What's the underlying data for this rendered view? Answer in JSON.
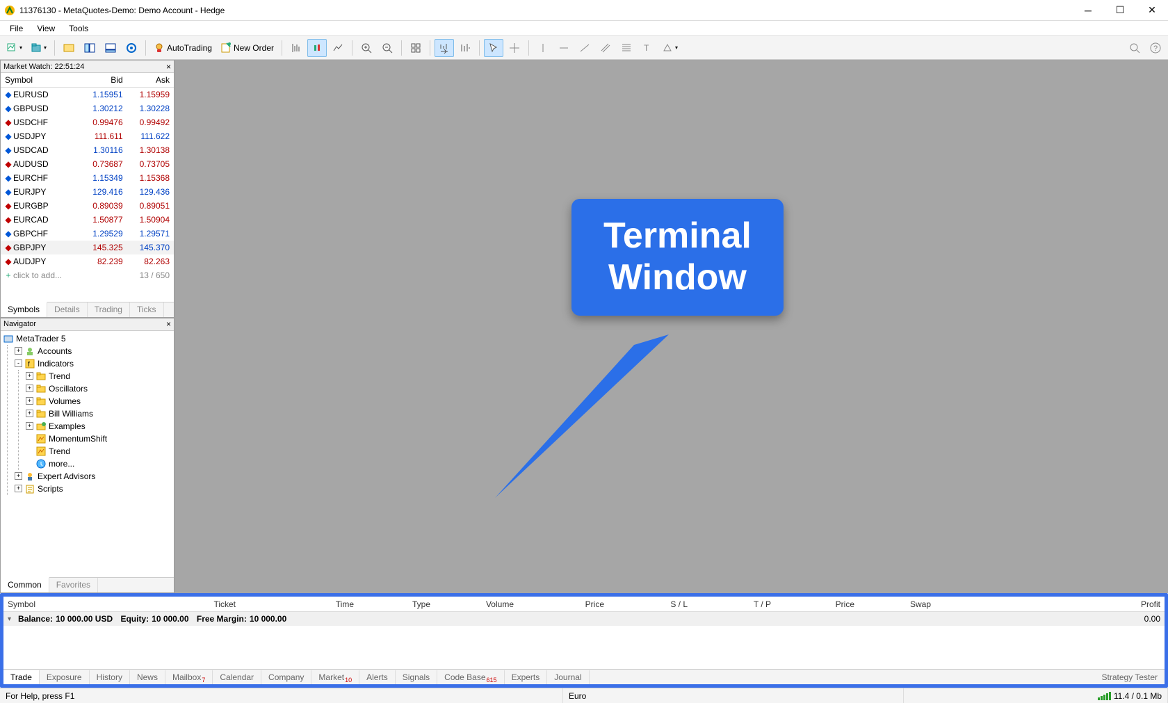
{
  "title": "11376130 - MetaQuotes-Demo: Demo Account - Hedge",
  "menu": [
    "File",
    "View",
    "Tools"
  ],
  "toolbar": {
    "autotrading": "AutoTrading",
    "neworder": "New Order"
  },
  "market_watch": {
    "header": "Market Watch: 22:51:24",
    "cols": {
      "symbol": "Symbol",
      "bid": "Bid",
      "ask": "Ask"
    },
    "rows": [
      {
        "arrow": "up",
        "sym": "EURUSD",
        "bid": "1.15951",
        "ask": "1.15959",
        "bidc": "up",
        "askc": "down"
      },
      {
        "arrow": "up",
        "sym": "GBPUSD",
        "bid": "1.30212",
        "ask": "1.30228",
        "bidc": "up",
        "askc": "up"
      },
      {
        "arrow": "down",
        "sym": "USDCHF",
        "bid": "0.99476",
        "ask": "0.99492",
        "bidc": "down",
        "askc": "down"
      },
      {
        "arrow": "up",
        "sym": "USDJPY",
        "bid": "111.611",
        "ask": "111.622",
        "bidc": "down",
        "askc": "up"
      },
      {
        "arrow": "up",
        "sym": "USDCAD",
        "bid": "1.30116",
        "ask": "1.30138",
        "bidc": "up",
        "askc": "down"
      },
      {
        "arrow": "down",
        "sym": "AUDUSD",
        "bid": "0.73687",
        "ask": "0.73705",
        "bidc": "down",
        "askc": "down"
      },
      {
        "arrow": "up",
        "sym": "EURCHF",
        "bid": "1.15349",
        "ask": "1.15368",
        "bidc": "up",
        "askc": "down"
      },
      {
        "arrow": "up",
        "sym": "EURJPY",
        "bid": "129.416",
        "ask": "129.436",
        "bidc": "up",
        "askc": "up"
      },
      {
        "arrow": "down",
        "sym": "EURGBP",
        "bid": "0.89039",
        "ask": "0.89051",
        "bidc": "down",
        "askc": "down"
      },
      {
        "arrow": "down",
        "sym": "EURCAD",
        "bid": "1.50877",
        "ask": "1.50904",
        "bidc": "down",
        "askc": "down"
      },
      {
        "arrow": "up",
        "sym": "GBPCHF",
        "bid": "1.29529",
        "ask": "1.29571",
        "bidc": "up",
        "askc": "up"
      },
      {
        "arrow": "down",
        "sym": "GBPJPY",
        "bid": "145.325",
        "ask": "145.370",
        "bidc": "down",
        "askc": "up",
        "sel": true
      },
      {
        "arrow": "down",
        "sym": "AUDJPY",
        "bid": "82.239",
        "ask": "82.263",
        "bidc": "down",
        "askc": "down"
      }
    ],
    "add_text": "click to add...",
    "counter": "13 / 650",
    "tabs": [
      "Symbols",
      "Details",
      "Trading",
      "Ticks"
    ]
  },
  "navigator": {
    "title": "Navigator",
    "root": "MetaTrader 5",
    "items": [
      {
        "exp": "+",
        "icon": "accounts",
        "label": "Accounts"
      },
      {
        "exp": "-",
        "icon": "indicators",
        "label": "Indicators",
        "children": [
          {
            "exp": "+",
            "icon": "folder",
            "label": "Trend"
          },
          {
            "exp": "+",
            "icon": "folder",
            "label": "Oscillators"
          },
          {
            "exp": "+",
            "icon": "folder",
            "label": "Volumes"
          },
          {
            "exp": "+",
            "icon": "folder",
            "label": "Bill Williams"
          },
          {
            "exp": "+",
            "icon": "examples",
            "label": "Examples"
          },
          {
            "exp": "",
            "icon": "ind",
            "label": "MomentumShift"
          },
          {
            "exp": "",
            "icon": "ind",
            "label": "Trend"
          },
          {
            "exp": "",
            "icon": "more",
            "label": "more..."
          }
        ]
      },
      {
        "exp": "+",
        "icon": "experts",
        "label": "Expert Advisors"
      },
      {
        "exp": "+",
        "icon": "scripts",
        "label": "Scripts"
      }
    ],
    "tabs": [
      "Common",
      "Favorites"
    ]
  },
  "callout": {
    "line1": "Terminal",
    "line2": "Window"
  },
  "terminal": {
    "cols": [
      "Symbol",
      "Ticket",
      "Time",
      "Type",
      "Volume",
      "Price",
      "S / L",
      "T / P",
      "Price",
      "Swap",
      "Profit"
    ],
    "balance_label": "Balance:",
    "balance": "10 000.00 USD",
    "equity_label": "Equity:",
    "equity": "10 000.00",
    "freemargin_label": "Free Margin:",
    "freemargin": "10 000.00",
    "profit": "0.00",
    "tabs": [
      {
        "label": "Trade",
        "active": true
      },
      {
        "label": "Exposure"
      },
      {
        "label": "History"
      },
      {
        "label": "News"
      },
      {
        "label": "Mailbox",
        "sub": "7"
      },
      {
        "label": "Calendar"
      },
      {
        "label": "Company"
      },
      {
        "label": "Market",
        "sub": "10"
      },
      {
        "label": "Alerts"
      },
      {
        "label": "Signals"
      },
      {
        "label": "Code Base",
        "sub": "615"
      },
      {
        "label": "Experts"
      },
      {
        "label": "Journal"
      }
    ],
    "right_tab": "Strategy Tester"
  },
  "statusbar": {
    "help": "For Help, press F1",
    "currency": "Euro",
    "traffic": "11.4 / 0.1 Mb"
  }
}
